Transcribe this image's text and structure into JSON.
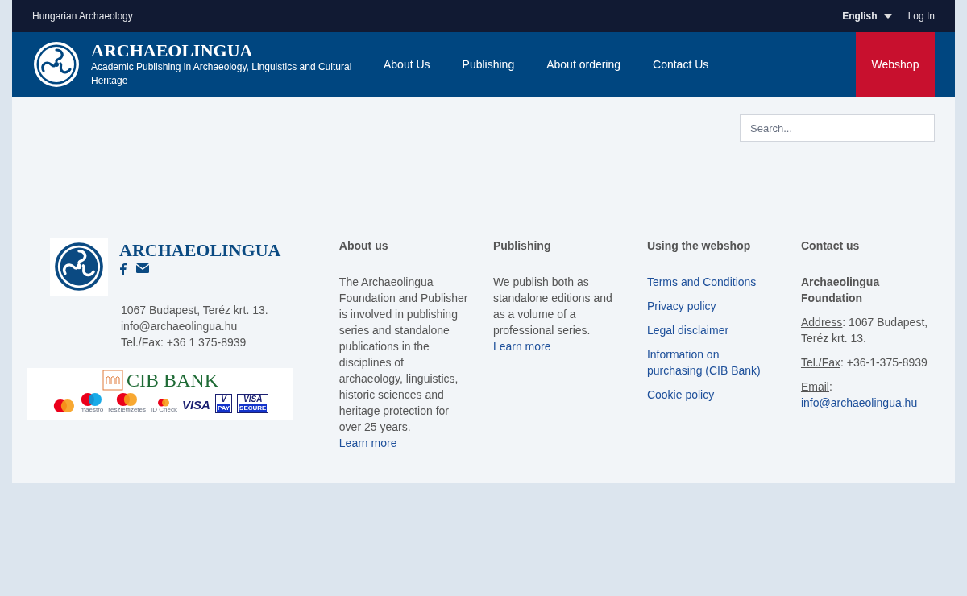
{
  "top_bar": {
    "site_link": "Hungarian Archaeology",
    "language": "English",
    "login": "Log In"
  },
  "header": {
    "brand": "ARCHAEOLINGUA",
    "tagline": "Academic Publishing in Archaeology, Linguistics and Cultural Heritage",
    "nav": [
      {
        "label": "About Us",
        "kind": "link"
      },
      {
        "label": "Publishing",
        "kind": "link"
      },
      {
        "label": "About ordering",
        "kind": "link"
      },
      {
        "label": "Contact Us",
        "kind": "link"
      },
      {
        "label": "Webshop",
        "kind": "shop"
      }
    ]
  },
  "search": {
    "placeholder": "Search..."
  },
  "footer": {
    "brand": "ARCHAEOLINGUA",
    "address_lines": [
      "1067 Budapest, Teréz krt. 13.",
      "info@archaeolingua.hu",
      "Tel./Fax: +36 1 375-8939"
    ],
    "payment": {
      "bank": "CIB BANK",
      "cards": [
        {
          "kind": "mastercard"
        },
        {
          "kind": "maestro",
          "label": "maestro"
        },
        {
          "kind": "mastercard",
          "label": "részletfizetés"
        },
        {
          "kind": "idcheck",
          "label": "ID Check"
        },
        {
          "kind": "visa",
          "label": "VISA"
        },
        {
          "kind": "vpay",
          "label": "V",
          "sub": "PAY"
        },
        {
          "kind": "visasecure",
          "label": "VISA",
          "sub": "SECURE"
        }
      ]
    },
    "columns": [
      {
        "heading": "About us",
        "kind": "text",
        "text": "The Archaeolingua Foundation and Publisher is involved in publishing series and standalone publications in the disciplines of archaeology, linguistics, historic sciences and heritage protection for over 25 years.",
        "link": "Learn more"
      },
      {
        "heading": "Publishing",
        "kind": "text",
        "text": "We publish both as standalone editions and as a volume of a professional series.",
        "link": "Learn more"
      },
      {
        "heading": "Using the webshop",
        "kind": "links",
        "links": [
          "Terms and Conditions",
          "Privacy policy",
          "Legal disclaimer",
          "Information on purchasing (CIB Bank)",
          "Cookie policy"
        ]
      },
      {
        "heading": "Contact us",
        "kind": "contact",
        "org": "Archaeolingua Foundation",
        "entries": [
          {
            "label": "Address",
            "value": ": 1067 Budapest, Teréz krt. 13.",
            "kind": "text"
          },
          {
            "label": "Tel./Fax",
            "value": ": +36-1-375-8939",
            "kind": "text"
          },
          {
            "label": "Email",
            "sep": ":",
            "value": "info@archaeolingua.hu",
            "kind": "link"
          }
        ]
      }
    ]
  }
}
